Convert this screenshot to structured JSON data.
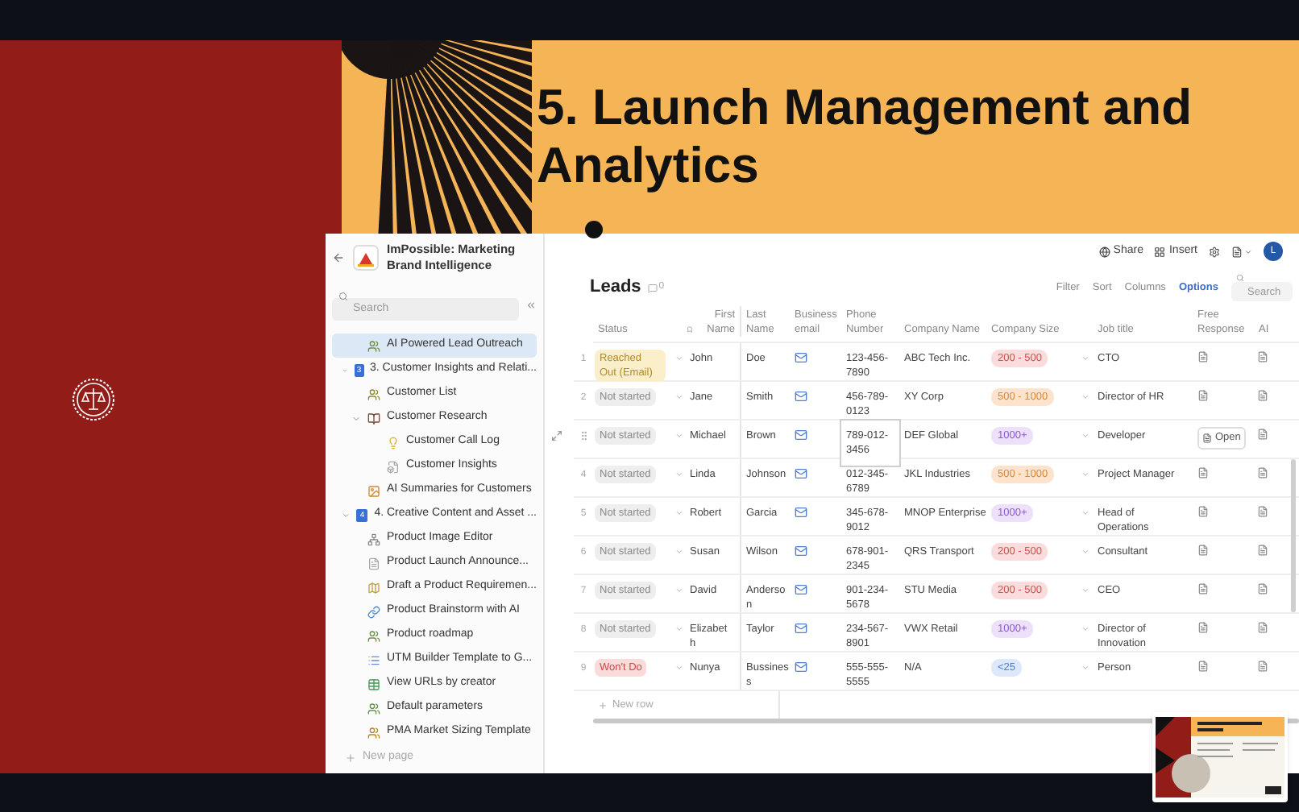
{
  "slide": {
    "title": "5. Launch Management and Analytics"
  },
  "app": {
    "title": "ImPossible: Marketing Brand Intelligence",
    "search": {
      "placeholder": "Search"
    },
    "sidebar": {
      "items": [
        {
          "label": "AI Powered Lead Outreach",
          "kind": "page",
          "selected": true
        },
        {
          "label": "3. Customer Insights and Relati...",
          "kind": "section",
          "number": "3",
          "expanded": true,
          "selected": false,
          "children": [
            {
              "label": "Customer List",
              "kind": "page",
              "selected": false
            },
            {
              "label": "Customer Research",
              "kind": "page",
              "expanded": true,
              "selected": false,
              "children": [
                {
                  "label": "Customer Call Log",
                  "kind": "page",
                  "selected": false
                },
                {
                  "label": "Customer Insights",
                  "kind": "page",
                  "selected": false
                }
              ]
            },
            {
              "label": "AI Summaries for Customers",
              "kind": "page",
              "selected": false
            }
          ]
        },
        {
          "label": "4. Creative Content and Asset ...",
          "kind": "section",
          "number": "4",
          "expanded": true,
          "selected": false,
          "children": [
            {
              "label": "Product Image Editor",
              "kind": "page",
              "selected": false
            },
            {
              "label": "Product Launch Announce...",
              "kind": "page",
              "selected": false
            },
            {
              "label": "Draft a Product Requiremen...",
              "kind": "page",
              "selected": false
            },
            {
              "label": "Product Brainstorm with AI",
              "kind": "page",
              "selected": false
            },
            {
              "label": "Product roadmap",
              "kind": "page",
              "selected": false
            },
            {
              "label": "UTM Builder Template to G...",
              "kind": "page",
              "selected": false
            },
            {
              "label": "View URLs by creator",
              "kind": "page",
              "selected": false
            },
            {
              "label": "Default parameters",
              "kind": "page",
              "selected": false
            },
            {
              "label": "PMA Market Sizing Template",
              "kind": "page",
              "selected": false
            }
          ]
        }
      ],
      "new_page": "New page"
    },
    "top_bar": {
      "share": "Share",
      "insert": "Insert",
      "avatar": "L"
    },
    "table": {
      "title": "Leads",
      "comment_count": "0",
      "toolbar": [
        {
          "label": "Filter",
          "selected": false
        },
        {
          "label": "Sort",
          "selected": false
        },
        {
          "label": "Columns",
          "selected": false
        },
        {
          "label": "Options",
          "selected": true
        }
      ],
      "search": {
        "placeholder": "Search"
      },
      "columns": [
        "Status",
        "First Name",
        "Last Name",
        "Business email",
        "Phone Number",
        "Company Name",
        "Company Size",
        "Job title",
        "Free Response",
        "AI"
      ],
      "rows": [
        {
          "index": "1",
          "status": {
            "label": "Reached Out (Email)",
            "kind": "reached"
          },
          "first_name": "John",
          "last_name": "Doe",
          "phone": "123-456-7890",
          "company": "ABC Tech Inc.",
          "size": {
            "label": "200 - 500",
            "color": "#fbdcdc"
          },
          "job_title": "CTO",
          "selected": false
        },
        {
          "index": "2",
          "status": {
            "label": "Not started",
            "kind": "idle"
          },
          "first_name": "Jane",
          "last_name": "Smith",
          "phone": "456-789-0123",
          "company": "XY Corp",
          "size": {
            "label": "500 - 1000",
            "color": "#fde3cc"
          },
          "job_title": "Director of HR",
          "selected": false
        },
        {
          "status": {
            "label": "Not started",
            "kind": "idle"
          },
          "first_name": "Michael",
          "last_name": "Brown",
          "phone": "789-012-3456",
          "company": "DEF Global",
          "size": {
            "label": "1000+",
            "color": "#ece0fb"
          },
          "job_title": "Developer",
          "open": "Open",
          "selected": true
        },
        {
          "index": "4",
          "status": {
            "label": "Not started",
            "kind": "idle"
          },
          "first_name": "Linda",
          "last_name": "Johnson",
          "phone": "012-345-6789",
          "company": "JKL Industries",
          "size": {
            "label": "500 - 1000",
            "color": "#fde3cc"
          },
          "job_title": "Project Manager",
          "selected": false
        },
        {
          "index": "5",
          "status": {
            "label": "Not started",
            "kind": "idle"
          },
          "first_name": "Robert",
          "last_name": "Garcia",
          "phone": "345-678-9012",
          "company": "MNOP Enterprise",
          "size": {
            "label": "1000+",
            "color": "#ece0fb"
          },
          "job_title": "Head of Operations",
          "selected": false
        },
        {
          "index": "6",
          "status": {
            "label": "Not started",
            "kind": "idle"
          },
          "first_name": "Susan",
          "last_name": "Wilson",
          "phone": "678-901-2345",
          "company": "QRS Transport",
          "size": {
            "label": "200 - 500",
            "color": "#fbdcdc"
          },
          "job_title": "Consultant",
          "selected": false
        },
        {
          "index": "7",
          "status": {
            "label": "Not started",
            "kind": "idle"
          },
          "first_name": "David",
          "last_name": "Anderson",
          "phone": "901-234-5678",
          "company": "STU Media",
          "size": {
            "label": "200 - 500",
            "color": "#fbdcdc"
          },
          "job_title": "CEO",
          "selected": false
        },
        {
          "index": "8",
          "status": {
            "label": "Not started",
            "kind": "idle"
          },
          "first_name": "Elizabeth",
          "last_name": "Taylor",
          "phone": "234-567-8901",
          "company": "VWX Retail",
          "size": {
            "label": "1000+",
            "color": "#ece0fb"
          },
          "job_title": "Director of Innovation",
          "selected": false
        },
        {
          "index": "9",
          "status": {
            "label": "Won't Do",
            "kind": "rejected"
          },
          "first_name": "Nunya",
          "last_name": "Bussiness",
          "phone": "555-555-5555",
          "company": "N/A",
          "size": {
            "label": "<25",
            "color": "#dde9fb"
          },
          "job_title": "Person",
          "selected": false
        }
      ],
      "new_row": "New row"
    }
  }
}
